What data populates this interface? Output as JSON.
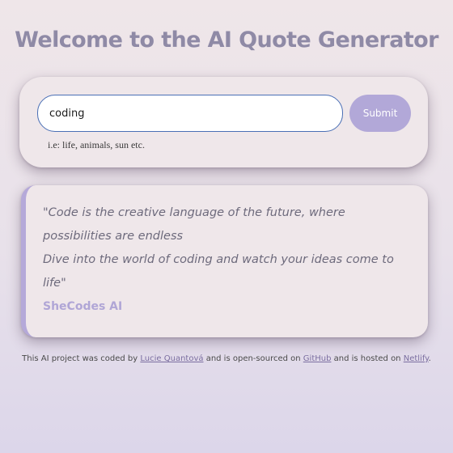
{
  "header": {
    "title": "Welcome to the AI Quote Generator"
  },
  "search": {
    "value": "coding",
    "submit_label": "Submit",
    "hint": "i.e: life, animals, sun etc."
  },
  "quote": {
    "line1": "\"Code is the creative language of the future, where possibilities are endless",
    "line2": "Dive into the world of coding and watch your ideas come to life\"",
    "author": "SheCodes AI"
  },
  "footer": {
    "text_1": "This AI project was coded by",
    "author_link": "Lucie Quantová",
    "text_2": "and is open-sourced on",
    "github_link": "GitHub",
    "text_3": "and is hosted on",
    "netlify_link": "Netlify",
    "text_4": "."
  },
  "colors": {
    "title": "#8f8aa6",
    "accent": "#b2a8d8",
    "input_border": "#4a6fb5",
    "card_bg": "#efe7ea"
  }
}
